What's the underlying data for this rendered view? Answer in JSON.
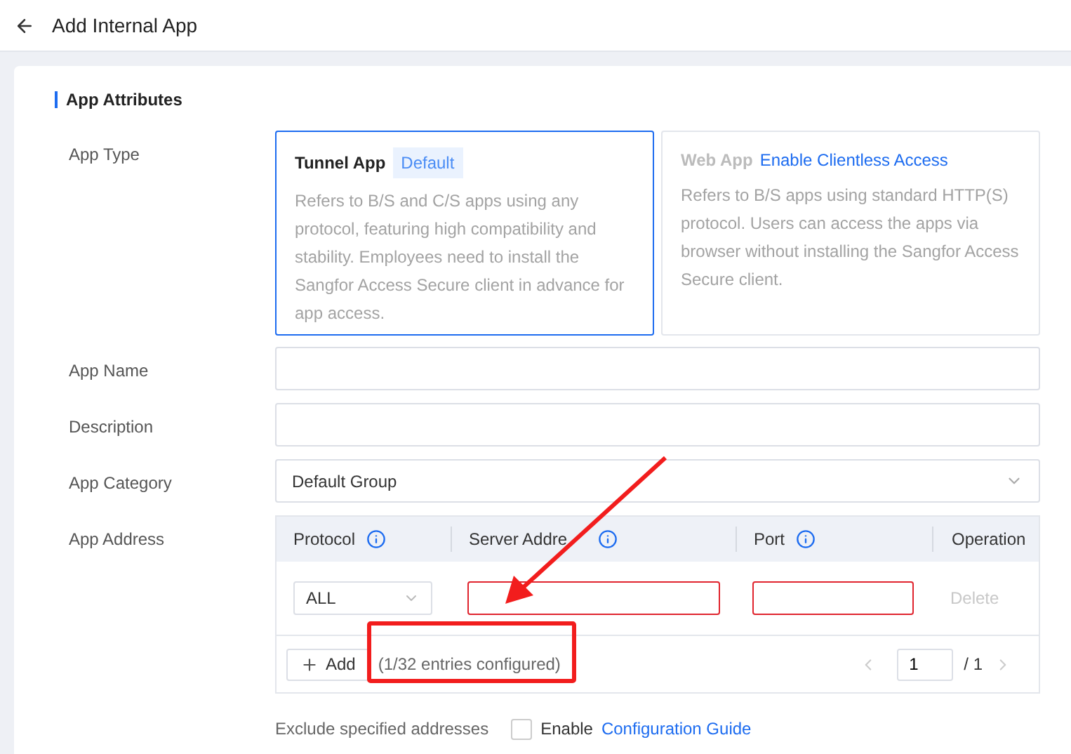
{
  "header": {
    "title": "Add Internal App"
  },
  "section": {
    "title": "App Attributes"
  },
  "app_type": {
    "label": "App Type",
    "options": [
      {
        "kind": "badge",
        "title": "Tunnel App",
        "extra": "Default",
        "description": "Refers to B/S and C/S apps using any protocol, featuring high compatibility and stability. Employees need to install the Sangfor Access Secure client in advance for app access.",
        "selected": true
      },
      {
        "kind": "link",
        "title": "Web App",
        "extra": "Enable Clientless Access",
        "description": "Refers to B/S apps using standard HTTP(S) protocol. Users can access the apps via browser without installing the Sangfor Access Secure client.",
        "selected": false
      }
    ]
  },
  "app_name": {
    "label": "App Name"
  },
  "description": {
    "label": "Description"
  },
  "app_category": {
    "label": "App Category",
    "value": "Default Group"
  },
  "app_address": {
    "label": "App Address",
    "columns": [
      {
        "label": "Protocol",
        "info": true
      },
      {
        "label": "Server Addre",
        "info": true
      },
      {
        "label": "Port",
        "info": true
      },
      {
        "label": "Operation",
        "info": false
      }
    ],
    "rows": [
      {
        "protocol": "ALL",
        "server_invalid": true,
        "port_invalid": true,
        "action": "Delete",
        "action_disabled": true
      }
    ],
    "add_button": "Add",
    "count": "(1/32 entries configured)",
    "page": "1",
    "total": "/ 1"
  },
  "exclude": {
    "label": "Exclude specified addresses",
    "checked": false,
    "checkbox_label": "Enable",
    "link": "Configuration Guide"
  }
}
